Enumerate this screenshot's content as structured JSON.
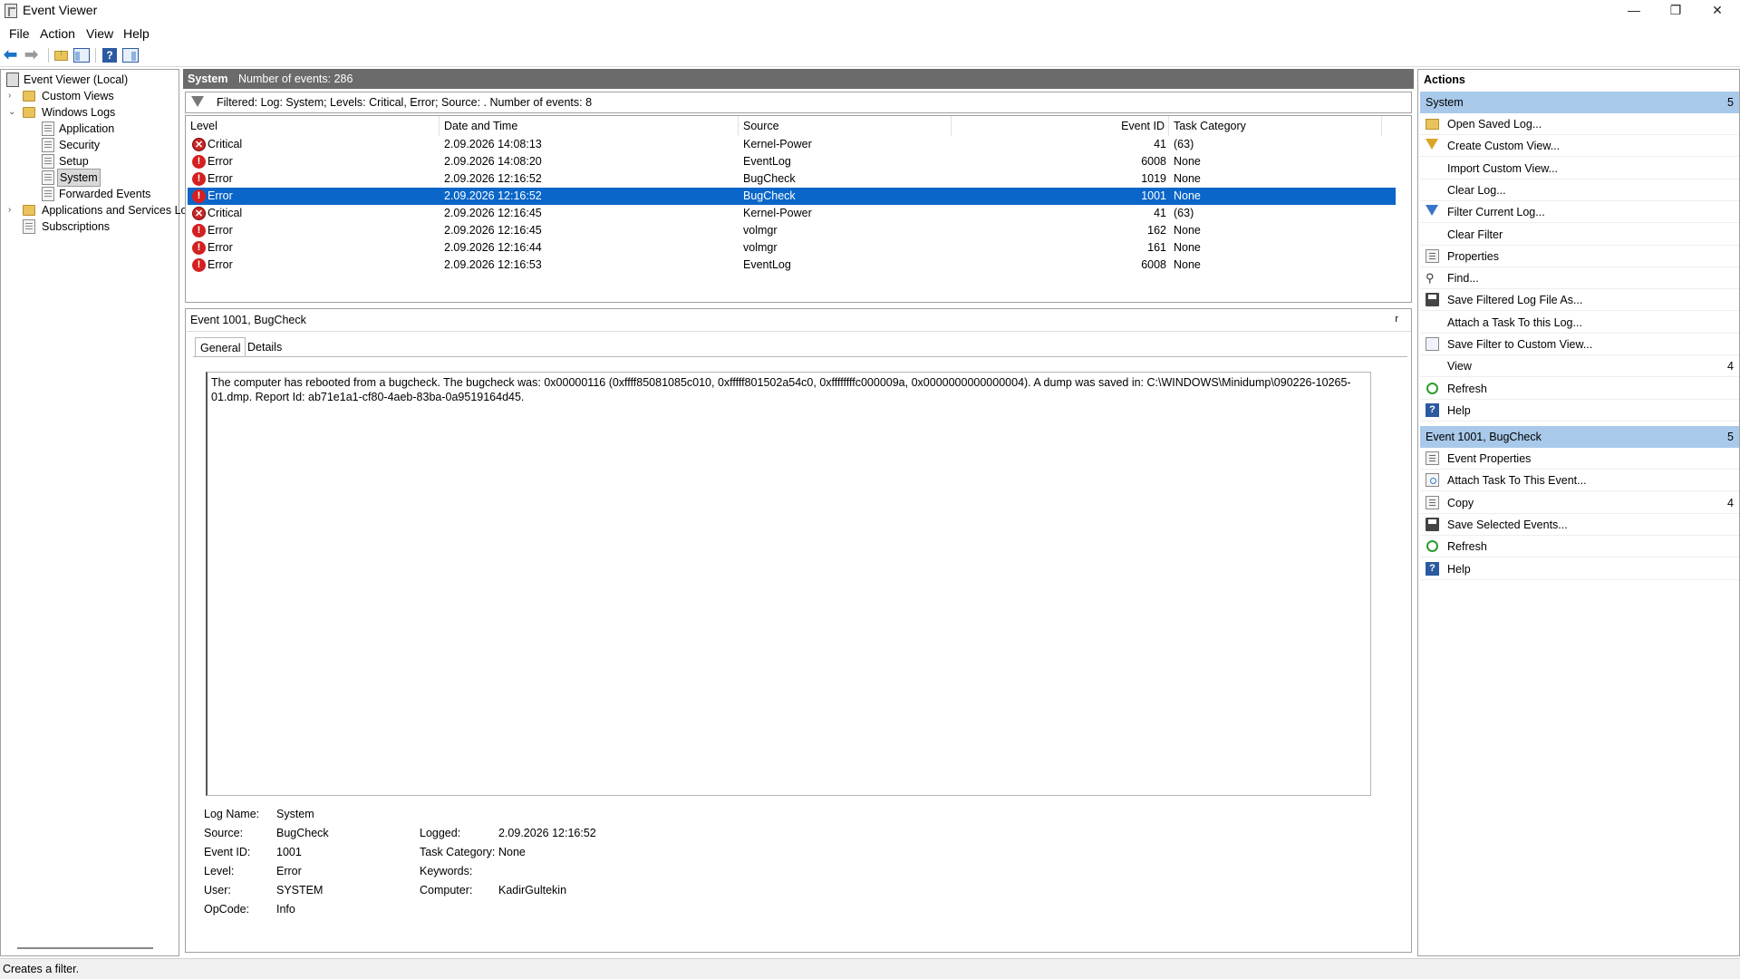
{
  "window": {
    "title": "Event Viewer",
    "controls": {
      "minimize": "—",
      "restore": "❐",
      "close": "✕"
    }
  },
  "menu": [
    "File",
    "Action",
    "View",
    "Help"
  ],
  "toolbar": [
    "back-icon",
    "forward-icon",
    "up-folder-icon",
    "show-hide-tree-icon",
    "help-icon",
    "action-pane-icon"
  ],
  "tree": {
    "root": "Event Viewer (Local)",
    "custom_views": "Custom Views",
    "windows_logs": "Windows Logs",
    "logs": [
      "Application",
      "Security",
      "Setup",
      "System",
      "Forwarded Events"
    ],
    "apps_services": "Applications and Services Lo",
    "subscriptions": "Subscriptions",
    "selected": "System"
  },
  "log_header": {
    "name": "System",
    "count": "Number of events: 286"
  },
  "filter": {
    "text": "Filtered: Log: System; Levels: Critical, Error; Source: . Number of events: 8"
  },
  "columns": {
    "level": "Level",
    "date": "Date and Time",
    "source": "Source",
    "event_id": "Event ID",
    "task": "Task Category"
  },
  "events": [
    {
      "level": "Critical",
      "date": "2.09.2026 14:08:13",
      "source": "Kernel-Power",
      "id": "41",
      "task": "(63)"
    },
    {
      "level": "Error",
      "date": "2.09.2026 14:08:20",
      "source": "EventLog",
      "id": "6008",
      "task": "None"
    },
    {
      "level": "Error",
      "date": "2.09.2026 12:16:52",
      "source": "BugCheck",
      "id": "1019",
      "task": "None"
    },
    {
      "level": "Error",
      "date": "2.09.2026 12:16:52",
      "source": "BugCheck",
      "id": "1001",
      "task": "None"
    },
    {
      "level": "Critical",
      "date": "2.09.2026 12:16:45",
      "source": "Kernel-Power",
      "id": "41",
      "task": "(63)"
    },
    {
      "level": "Error",
      "date": "2.09.2026 12:16:45",
      "source": "volmgr",
      "id": "162",
      "task": "None"
    },
    {
      "level": "Error",
      "date": "2.09.2026 12:16:44",
      "source": "volmgr",
      "id": "161",
      "task": "None"
    },
    {
      "level": "Error",
      "date": "2.09.2026 12:16:53",
      "source": "EventLog",
      "id": "6008",
      "task": "None"
    }
  ],
  "detail": {
    "title": "Event 1001, BugCheck",
    "close": "r",
    "tabs": [
      "General",
      "Details"
    ],
    "message": "The computer has rebooted from a bugcheck.  The bugcheck was: 0x00000116 (0xffff85081085c010, 0xfffff801502a54c0, 0xffffffffc000009a, 0x0000000000000004). A dump was saved in: C:\\WINDOWS\\Minidump\\090226-10265-01.dmp. Report Id: ab71e1a1-cf80-4aeb-83ba-0a9519164d45.",
    "props": {
      "log_name_label": "Log Name:",
      "log_name": "System",
      "source_label": "Source:",
      "source": "BugCheck",
      "logged_label": "Logged:",
      "logged": "2.09.2026 12:16:52",
      "event_id_label": "Event ID:",
      "event_id": "1001",
      "task_label": "Task Category:",
      "task": "None",
      "level_label": "Level:",
      "level": "Error",
      "keywords_label": "Keywords:",
      "keywords": "",
      "user_label": "User:",
      "user": "SYSTEM",
      "computer_label": "Computer:",
      "computer": "KadirGultekin",
      "opcode_label": "OpCode:",
      "opcode": "Info"
    }
  },
  "actions": {
    "header": "Actions",
    "system_section": {
      "title": "System",
      "count": "5"
    },
    "system_items": [
      {
        "label": "Open Saved Log...",
        "icon": "open-folder-icon"
      },
      {
        "label": "Create Custom View...",
        "icon": "funnel-gold-icon"
      },
      {
        "label": "Import Custom View...",
        "icon": ""
      },
      {
        "label": "Clear Log...",
        "icon": ""
      },
      {
        "label": "Filter Current Log...",
        "icon": "funnel-icon"
      },
      {
        "label": "Clear Filter",
        "icon": ""
      },
      {
        "label": "Properties",
        "icon": "properties-icon"
      },
      {
        "label": "Find...",
        "icon": "find-icon"
      },
      {
        "label": "Save Filtered Log File As...",
        "icon": "save-icon"
      },
      {
        "label": "Attach a Task To this Log...",
        "icon": ""
      },
      {
        "label": "Save Filter to Custom View...",
        "icon": "filter-save-icon"
      },
      {
        "label": "View",
        "icon": "",
        "sub": "4"
      },
      {
        "label": "Refresh",
        "icon": "refresh-icon"
      },
      {
        "label": "Help",
        "icon": "help-icon",
        "sub": ""
      }
    ],
    "event_section": {
      "title": "Event 1001, BugCheck",
      "count": "5"
    },
    "event_items": [
      {
        "label": "Event Properties",
        "icon": "properties-icon"
      },
      {
        "label": "Attach Task To This Event...",
        "icon": "task-icon"
      },
      {
        "label": "Copy",
        "icon": "copy-icon",
        "sub": "4"
      },
      {
        "label": "Save Selected Events...",
        "icon": "save-icon"
      },
      {
        "label": "Refresh",
        "icon": "refresh-icon"
      },
      {
        "label": "Help",
        "icon": "help-icon"
      }
    ]
  },
  "status": "Creates a filter.",
  "colors": {
    "selection": "#0a66c9",
    "section_header": "#a8c9ea",
    "log_header": "#6b6b6b",
    "error": "#d42020"
  }
}
